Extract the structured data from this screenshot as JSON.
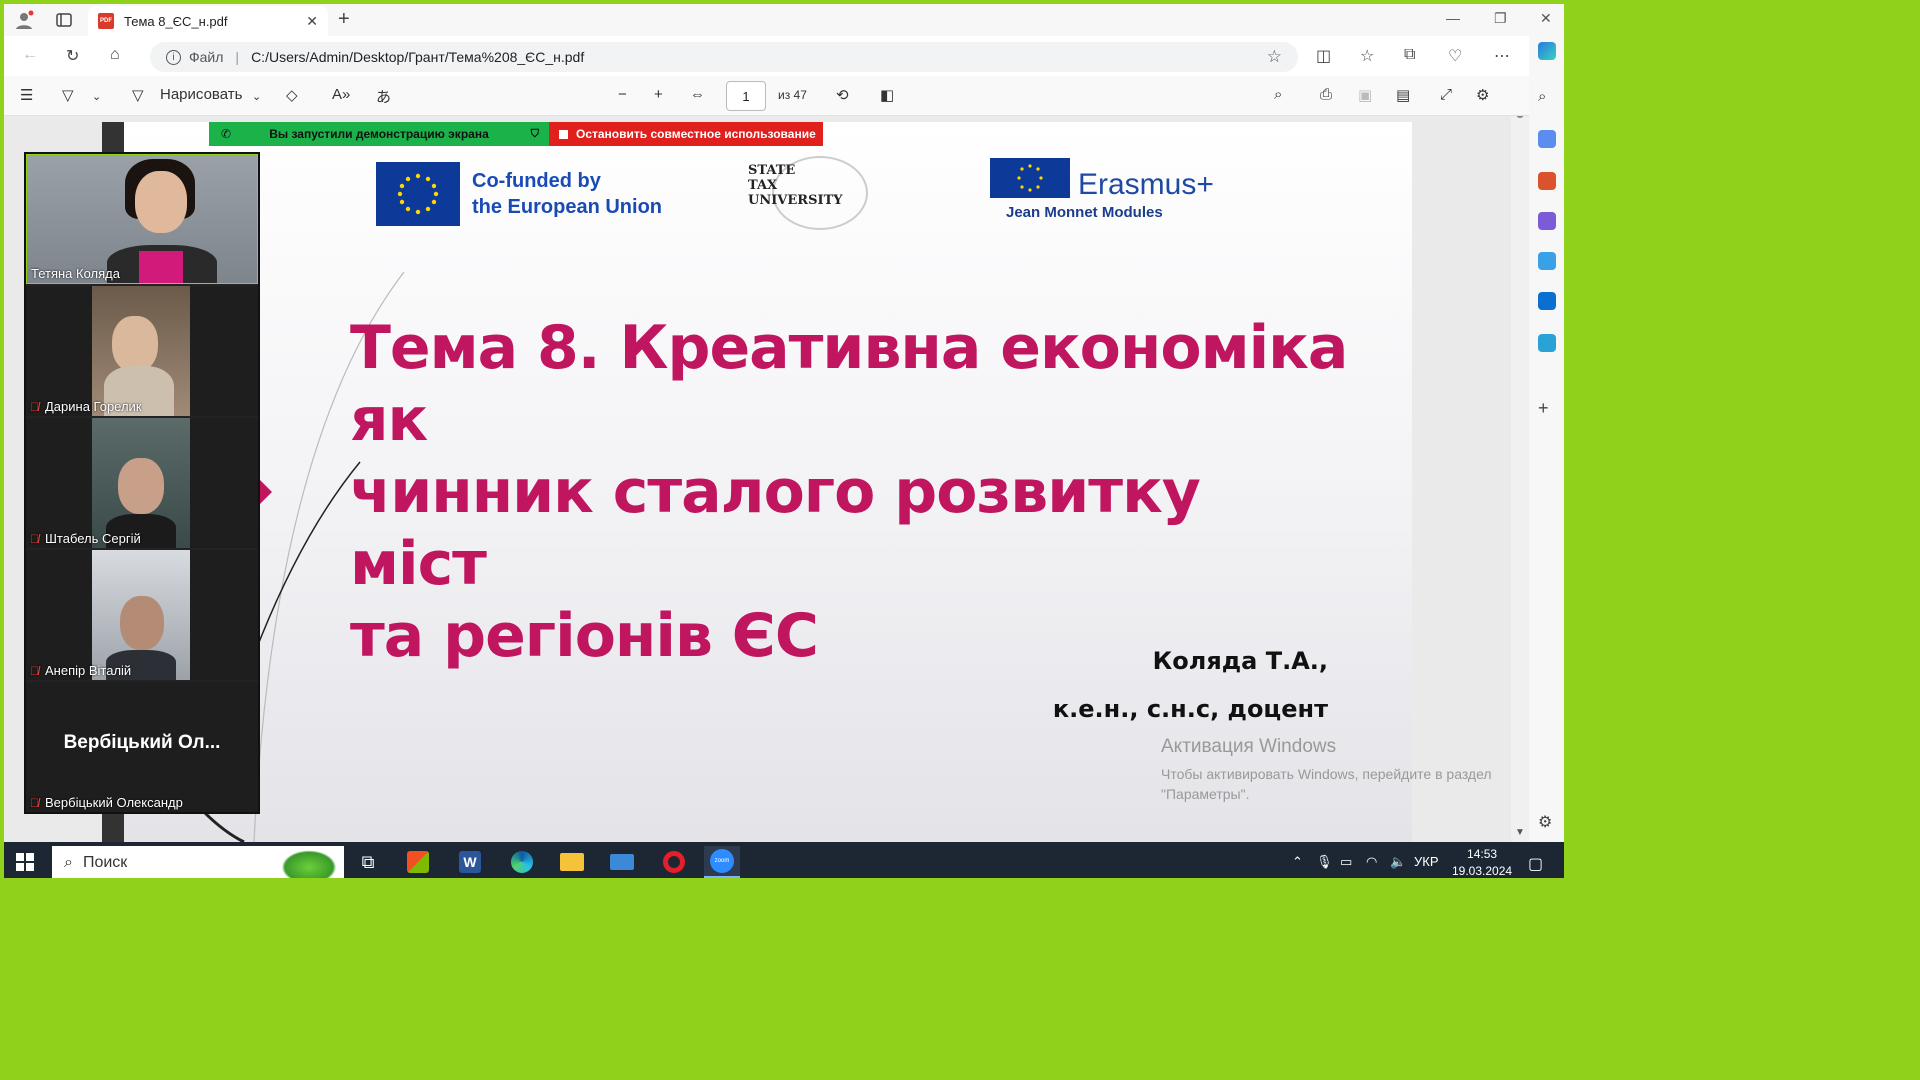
{
  "browser": {
    "tab_title": "Тема 8_ЄС_н.pdf",
    "address_label": "Файл",
    "address_url": "C:/Users/Admin/Desktop/Грант/Тема%208_ЄС_н.pdf"
  },
  "pdf_toolbar": {
    "draw_label": "Нарисовать",
    "page_current": "1",
    "page_total_label": "из 47"
  },
  "share_banner": {
    "sharing_text": "Вы запустили демонстрацию экрана",
    "stop_text": "Остановить совместное использование"
  },
  "slide": {
    "eu_logo_line1": "Co-funded by",
    "eu_logo_line2": "the European Union",
    "university_line1": "STATE",
    "university_line2": "TAX",
    "university_line3": "UNIVERSITY",
    "erasmus_text": "Erasmus+",
    "erasmus_sub": "Jean Monnet Modules",
    "title_line1": "Тема 8. Креативна економіка як",
    "title_line2": "чинник сталого розвитку міст",
    "title_line3": "та регіонів ЄС",
    "author_line1": "Коляда Т.А.,",
    "author_line2": "к.е.н., с.н.с, доцент"
  },
  "watermark": {
    "title": "Активация Windows",
    "line1": "Чтобы активировать Windows, перейдите в раздел",
    "line2": "\"Параметры\"."
  },
  "participants": [
    {
      "name": "Тетяна Коляда",
      "muted": false
    },
    {
      "name": "Дарина Горелик",
      "muted": true
    },
    {
      "name": "Штабель Сергій",
      "muted": true
    },
    {
      "name": "Анепір Віталій",
      "muted": true
    },
    {
      "name": "Вербіцький Олександр",
      "muted": true,
      "display_label": "Вербіцький Ол..."
    }
  ],
  "taskbar": {
    "search_label": "Поиск",
    "language": "УКР",
    "time": "14:53",
    "date": "19.03.2024"
  },
  "colors": {
    "title_magenta": "#c0155f",
    "share_green": "#1bb24a",
    "share_red": "#e0201d",
    "eu_blue": "#0d3a99",
    "frame_green": "#8fd11b"
  }
}
